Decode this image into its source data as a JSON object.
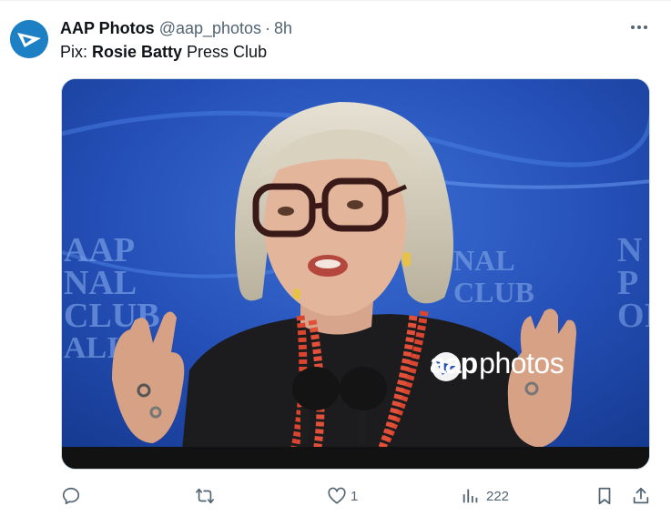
{
  "tweet": {
    "display_name": "AAP Photos",
    "handle": "@aap_photos",
    "separator": "·",
    "time": "8h",
    "text_prefix": "Pix: ",
    "text_bold": "Rosie Batty",
    "text_suffix": " Press Club"
  },
  "media": {
    "watermark_bold": "aap",
    "watermark_regular": "photos",
    "background_letters": "NAL CLUB ALIA"
  },
  "actions": {
    "reply_count": "",
    "retweet_count": "",
    "like_count": "1",
    "views_count": "222"
  },
  "colors": {
    "text_primary": "#0f1419",
    "text_secondary": "#536471",
    "avatar_blue": "#1d7fc4",
    "media_blue": "#1a3a9a"
  },
  "icons": {
    "more": "more-dots-icon",
    "reply": "reply-icon",
    "retweet": "retweet-icon",
    "like": "heart-icon",
    "views": "views-chart-icon",
    "bookmark": "bookmark-icon",
    "share": "share-icon"
  }
}
